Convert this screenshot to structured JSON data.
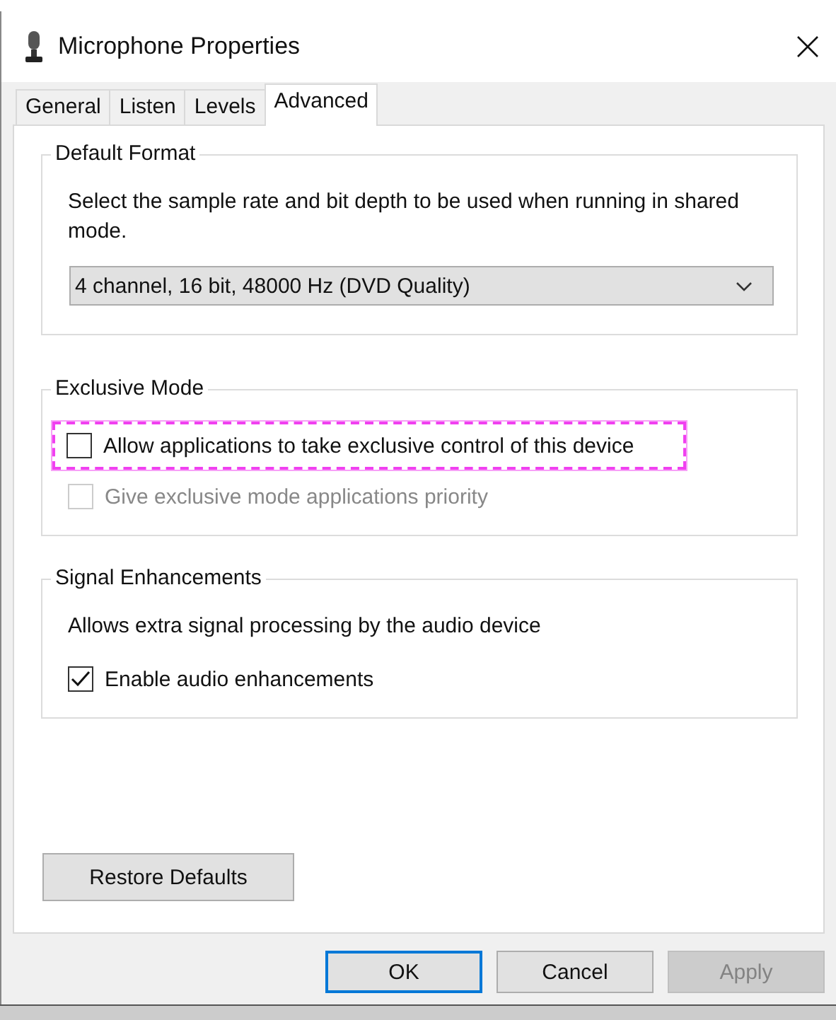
{
  "window": {
    "title": "Microphone Properties"
  },
  "tabs": [
    {
      "label": "General",
      "selected": false
    },
    {
      "label": "Listen",
      "selected": false
    },
    {
      "label": "Levels",
      "selected": false
    },
    {
      "label": "Advanced",
      "selected": true
    }
  ],
  "groups": [
    {
      "title": "Default Format",
      "description": "Select the sample rate and bit depth to be used when running in shared mode.",
      "dropdown": {
        "value": "4 channel, 16 bit, 48000 Hz (DVD Quality)"
      }
    },
    {
      "title": "Exclusive Mode",
      "checkboxes": [
        {
          "label": "Allow applications to take exclusive control of this device",
          "checked": false,
          "disabled": false,
          "highlighted": true
        },
        {
          "label": "Give exclusive mode applications priority",
          "checked": false,
          "disabled": true,
          "highlighted": false
        }
      ]
    },
    {
      "title": "Signal Enhancements",
      "description": "Allows extra signal processing by the audio device",
      "checkboxes": [
        {
          "label": "Enable audio enhancements",
          "checked": true,
          "disabled": false,
          "highlighted": false
        }
      ]
    }
  ],
  "restore_button": "Restore Defaults",
  "buttons": [
    {
      "label": "OK",
      "disabled": false,
      "default": true
    },
    {
      "label": "Cancel",
      "disabled": false,
      "default": false
    },
    {
      "label": "Apply",
      "disabled": true,
      "default": false
    }
  ]
}
